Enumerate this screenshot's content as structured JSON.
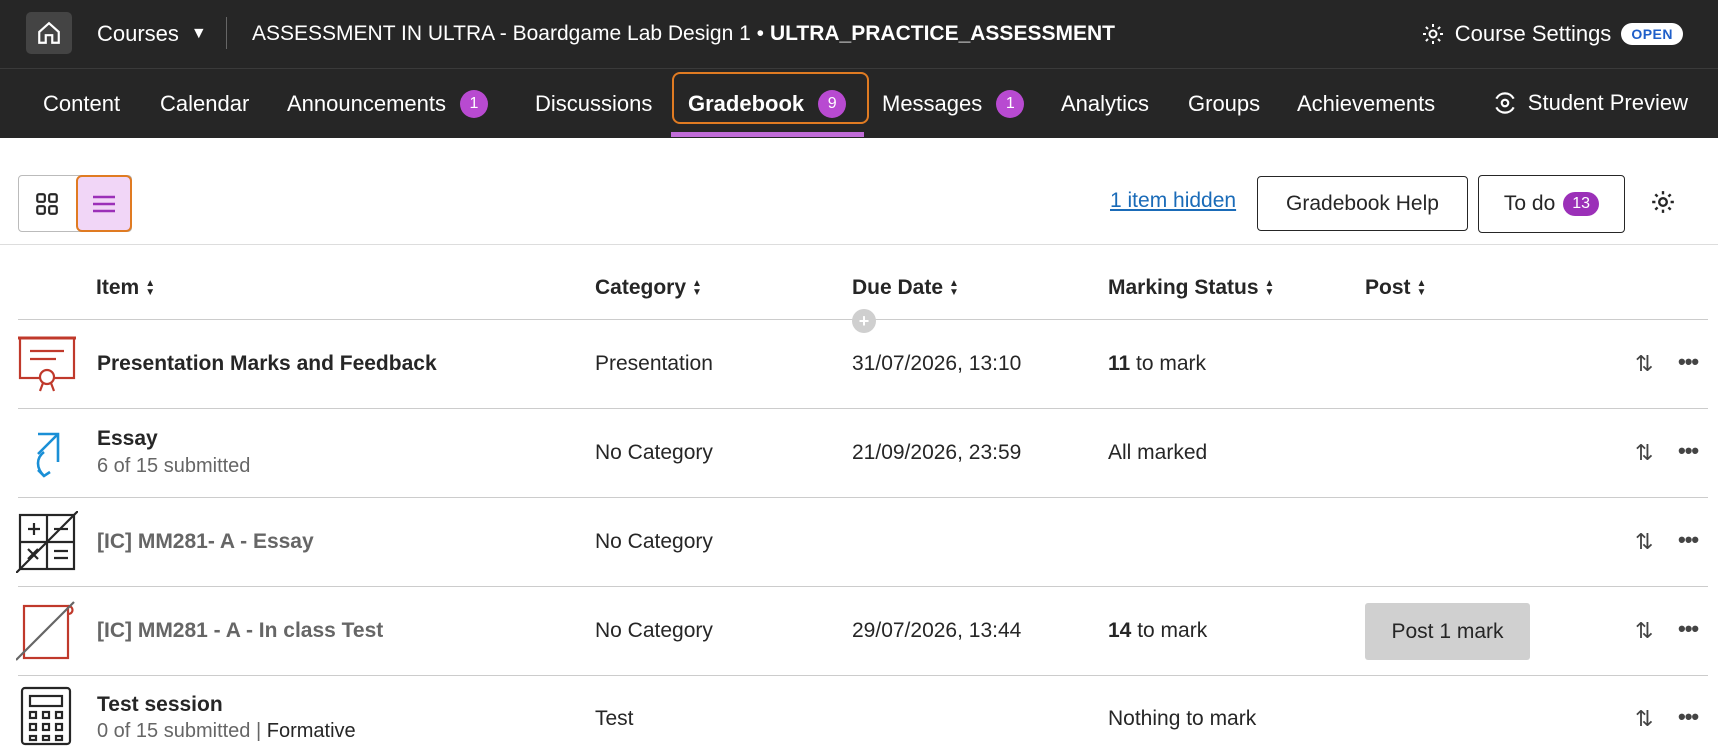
{
  "topbar": {
    "courses_label": "Courses",
    "course_title": "ASSESSMENT IN ULTRA - Boardgame Lab Design 1 •",
    "course_id": "ULTRA_PRACTICE_ASSESSMENT",
    "settings_label": "Course Settings",
    "status_badge": "OPEN"
  },
  "nav": {
    "items": [
      {
        "label": "Content"
      },
      {
        "label": "Calendar"
      },
      {
        "label": "Announcements",
        "badge": "1"
      },
      {
        "label": "Discussions"
      },
      {
        "label": "Gradebook",
        "badge": "9"
      },
      {
        "label": "Messages",
        "badge": "1"
      },
      {
        "label": "Analytics"
      },
      {
        "label": "Groups"
      },
      {
        "label": "Achievements"
      }
    ],
    "student_preview": "Student Preview"
  },
  "toolbar": {
    "hidden_link": "1 item hidden",
    "help_button": "Gradebook Help",
    "todo_label": "To do",
    "todo_count": "13"
  },
  "table": {
    "headers": [
      "Item",
      "Category",
      "Due Date",
      "Marking Status",
      "Post"
    ],
    "rows": [
      {
        "title": "Presentation Marks and Feedback",
        "category": "Presentation",
        "due": "31/07/2026, 13:10",
        "status_count": "11",
        "status_text": " to mark",
        "icon": "presentation-icon"
      },
      {
        "title": "Essay",
        "sub": "6 of 15 submitted",
        "category": "No Category",
        "due": "21/09/2026, 23:59",
        "status_text": "All marked",
        "icon": "assignment-icon"
      },
      {
        "title": "[IC] MM281- A - Essay",
        "category": "No Category",
        "due": "",
        "status_text": "",
        "icon": "calculation-icon"
      },
      {
        "title": "[IC] MM281 - A - In class Test",
        "category": "No Category",
        "due": "29/07/2026, 13:44",
        "status_count": "14",
        "status_text": " to mark",
        "post": "Post 1 mark",
        "icon": "offline-item-icon"
      },
      {
        "title": "Test session",
        "sub": "0 of 15 submitted",
        "sub_sep": "|",
        "sub_tag": "Formative",
        "category": "Test",
        "due": "",
        "status_text": "Nothing to mark",
        "icon": "test-icon"
      }
    ]
  }
}
